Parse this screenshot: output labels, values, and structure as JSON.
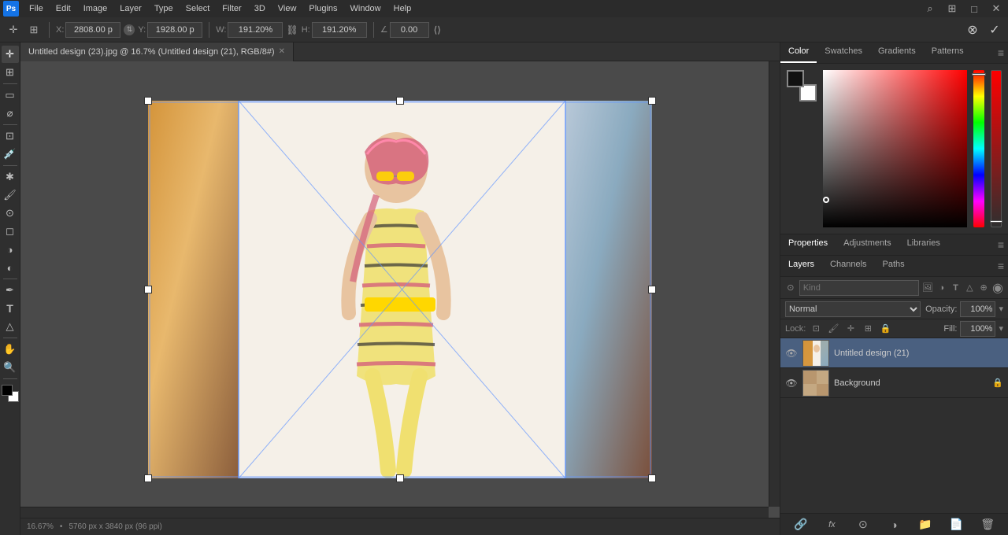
{
  "app": {
    "name": "Photoshop",
    "icon_label": "Ps"
  },
  "menu": {
    "items": [
      "File",
      "Edit",
      "Image",
      "Layer",
      "Type",
      "Select",
      "Filter",
      "3D",
      "View",
      "Plugins",
      "Window",
      "Help"
    ]
  },
  "options_bar": {
    "x_label": "X:",
    "x_value": "2808.00 p",
    "y_label": "Y:",
    "y_value": "1928.00 p",
    "w_label": "W:",
    "w_value": "191.20%",
    "h_label": "H:",
    "h_value": "191.20%",
    "angle_label": "∠",
    "angle_value": "0.00",
    "cancel_tooltip": "Cancel transform",
    "confirm_tooltip": "Confirm transform"
  },
  "tab": {
    "title": "Untitled design (23).jpg @ 16.7% (Untitled design (21), RGB/8#)"
  },
  "status_bar": {
    "zoom": "16.67%",
    "dimensions": "5760 px x 3840 px (96 ppi)"
  },
  "color_panel": {
    "tabs": [
      "Color",
      "Swatches",
      "Gradients",
      "Patterns"
    ],
    "active_tab": "Color"
  },
  "properties_panel": {
    "tabs": [
      "Properties",
      "Adjustments",
      "Libraries"
    ],
    "active_tab": "Properties"
  },
  "layers_panel": {
    "tabs": [
      "Layers",
      "Channels",
      "Paths"
    ],
    "active_tab": "Layers",
    "search_placeholder": "Kind",
    "blend_mode": "Normal",
    "opacity_label": "Opacity:",
    "opacity_value": "100%",
    "lock_label": "Lock:",
    "fill_label": "Fill:",
    "fill_value": "100%",
    "layers": [
      {
        "id": 1,
        "name": "Untitled design (21)",
        "visible": true,
        "selected": true,
        "thumb_color": "#8B7355",
        "has_lock": false
      },
      {
        "id": 2,
        "name": "Background",
        "visible": true,
        "selected": false,
        "thumb_color": "#C4A882",
        "has_lock": true
      }
    ]
  },
  "tools": [
    {
      "id": "move",
      "icon": "✛",
      "active": true
    },
    {
      "id": "artboard",
      "icon": "⊞",
      "active": false
    },
    {
      "id": "select-rect",
      "icon": "▭",
      "active": false
    },
    {
      "id": "lasso",
      "icon": "⌀",
      "active": false
    },
    {
      "id": "pen",
      "icon": "✏",
      "active": false
    },
    {
      "id": "paint",
      "icon": "⁍",
      "active": false
    },
    {
      "id": "clone",
      "icon": "⊙",
      "active": false
    },
    {
      "id": "eraser",
      "icon": "◻",
      "active": false
    },
    {
      "id": "blur",
      "icon": "◌",
      "active": false
    },
    {
      "id": "dodge",
      "icon": "◑",
      "active": false
    },
    {
      "id": "pen2",
      "icon": "✒",
      "active": false
    },
    {
      "id": "text",
      "icon": "T",
      "active": false
    },
    {
      "id": "shape",
      "icon": "△",
      "active": false
    },
    {
      "id": "hand",
      "icon": "✋",
      "active": false
    },
    {
      "id": "zoom",
      "icon": "🔍",
      "active": false
    }
  ]
}
